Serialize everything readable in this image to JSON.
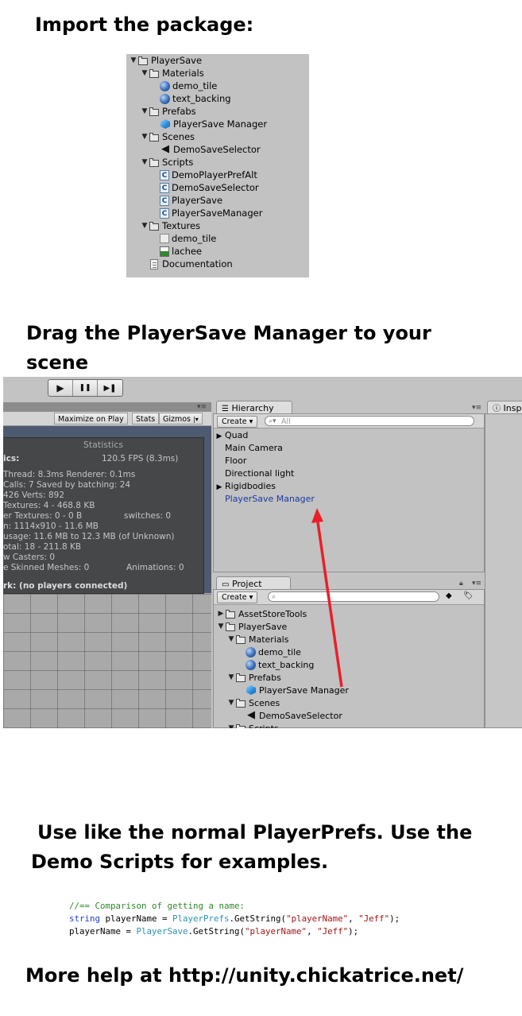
{
  "headings": {
    "import": "Import the package:",
    "drag_line1": "Drag the PlayerSave Manager to your",
    "drag_line2": "scene",
    "use_line1": "Use like the normal PlayerPrefs. Use the",
    "use_line2": "Demo Scripts for examples.",
    "help": "More help at http://unity.chickatrice.net/"
  },
  "package_tree": [
    {
      "label": "PlayerSave",
      "icon": "folder-icon",
      "depth": 0,
      "expanded": true
    },
    {
      "label": "Materials",
      "icon": "folder-icon",
      "depth": 1,
      "expanded": true
    },
    {
      "label": "demo_tile",
      "icon": "material-icon",
      "depth": 2
    },
    {
      "label": "text_backing",
      "icon": "material-icon",
      "depth": 2
    },
    {
      "label": "Prefabs",
      "icon": "folder-icon",
      "depth": 1,
      "expanded": true
    },
    {
      "label": "PlayerSave Manager",
      "icon": "prefab-icon",
      "depth": 2
    },
    {
      "label": "Scenes",
      "icon": "folder-icon",
      "depth": 1,
      "expanded": true
    },
    {
      "label": "DemoSaveSelector",
      "icon": "unity-scene-icon",
      "depth": 2
    },
    {
      "label": "Scripts",
      "icon": "folder-icon",
      "depth": 1,
      "expanded": true
    },
    {
      "label": "DemoPlayerPrefAlt",
      "icon": "csharp-script-icon",
      "depth": 2
    },
    {
      "label": "DemoSaveSelector",
      "icon": "csharp-script-icon",
      "depth": 2
    },
    {
      "label": "PlayerSave",
      "icon": "csharp-script-icon",
      "depth": 2
    },
    {
      "label": "PlayerSaveManager",
      "icon": "csharp-script-icon",
      "depth": 2
    },
    {
      "label": "Textures",
      "icon": "folder-icon",
      "depth": 1,
      "expanded": true
    },
    {
      "label": "demo_tile",
      "icon": "texture-icon",
      "depth": 2
    },
    {
      "label": "lachee",
      "icon": "texture-icon",
      "depth": 2
    },
    {
      "label": "Documentation",
      "icon": "document-icon",
      "depth": 1
    }
  ],
  "editor": {
    "play_controls": {
      "play": "▶",
      "pause": "❚❚",
      "step": "▶❚"
    },
    "game_bar": {
      "maximize": "Maximize on Play",
      "stats": "Stats",
      "gizmos": "Gizmos"
    },
    "stats": {
      "title": "Statistics",
      "lines": [
        "ics:",
        "120.5 FPS (8.3ms)",
        "Thread: 8.3ms  Renderer: 0.1ms",
        "Calls: 7        Saved by batching: 24",
        "426  Verts: 892",
        "Textures: 4 - 468.8 KB",
        "er Textures: 0 - 0 B",
        "switches: 0",
        "n: 1114x910 - 11.6 MB",
        " usage: 11.6 MB to 12.3 MB (of Unknown)",
        "otal: 18 - 211.8 KB",
        "w Casters: 0",
        "e Skinned Meshes: 0",
        "Animations: 0",
        "rk: (no players connected)"
      ]
    },
    "hierarchy": {
      "tab": "Hierarchy",
      "create": "Create",
      "search_placeholder": "All",
      "items": [
        {
          "label": "Quad",
          "has_children": true
        },
        {
          "label": "Main Camera",
          "has_children": false
        },
        {
          "label": "Floor",
          "has_children": false
        },
        {
          "label": "Directional light",
          "has_children": false
        },
        {
          "label": "Rigidbodies",
          "has_children": true
        },
        {
          "label": "PlayerSave Manager",
          "has_children": false,
          "selected": true
        }
      ]
    },
    "inspector": {
      "tab": "Insp"
    },
    "project": {
      "tab": "Project",
      "create": "Create",
      "items": [
        {
          "label": "AssetStoreTools",
          "icon": "folder-icon",
          "depth": 0,
          "expanded": false
        },
        {
          "label": "PlayerSave",
          "icon": "folder-icon",
          "depth": 0,
          "expanded": true
        },
        {
          "label": "Materials",
          "icon": "folder-icon",
          "depth": 1,
          "expanded": true
        },
        {
          "label": "demo_tile",
          "icon": "material-icon",
          "depth": 2
        },
        {
          "label": "text_backing",
          "icon": "material-icon",
          "depth": 2
        },
        {
          "label": "Prefabs",
          "icon": "folder-icon",
          "depth": 1,
          "expanded": true
        },
        {
          "label": "PlayerSave Manager",
          "icon": "prefab-icon",
          "depth": 2
        },
        {
          "label": "Scenes",
          "icon": "folder-icon",
          "depth": 1,
          "expanded": true
        },
        {
          "label": "DemoSaveSelector",
          "icon": "unity-scene-icon",
          "depth": 2
        },
        {
          "label": "Scripts",
          "icon": "folder-icon",
          "depth": 1,
          "expanded": true
        }
      ]
    },
    "arrow_color": "#e8202a"
  },
  "code": {
    "comment": "//== Comparison of getting a name:",
    "line2": {
      "kw": "string",
      "var": " playerName = ",
      "cls": "PlayerPrefs",
      "call": ".GetString(",
      "s1": "\"playerName\"",
      "sep": ", ",
      "s2": "\"Jeff\"",
      "end": ");"
    },
    "line3": {
      "var": "playerName = ",
      "cls": "PlayerSave",
      "call": ".GetString(",
      "s1": "\"playerName\"",
      "sep": ", ",
      "s2": "\"Jeff\"",
      "end": ");"
    }
  }
}
